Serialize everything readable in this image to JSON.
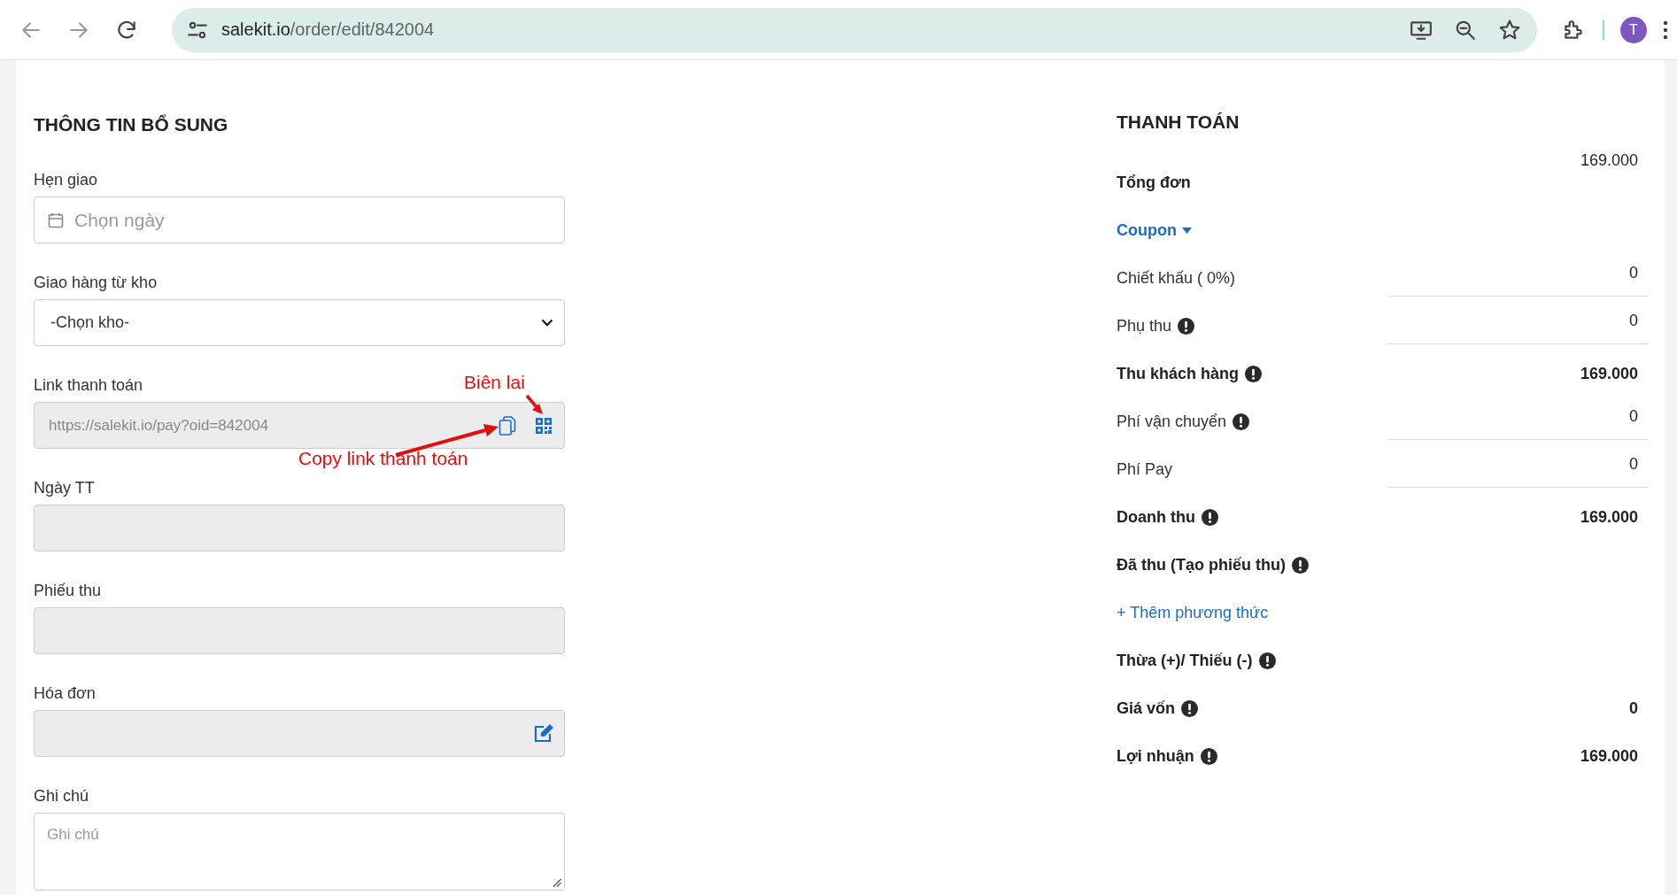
{
  "browser": {
    "url_host": "salekit.io",
    "url_path": "/order/edit/842004",
    "avatar_letter": "T"
  },
  "info": {
    "title": "THÔNG TIN BỔ SUNG",
    "fields": [
      {
        "kind": "date",
        "label": "Hẹn giao",
        "placeholder": "Chọn ngày"
      },
      {
        "kind": "select",
        "label": "Giao hàng từ kho",
        "value": "-Chọn kho-"
      },
      {
        "kind": "link",
        "label": "Link thanh toán",
        "value": "https://salekit.io/pay?oid=842004"
      },
      {
        "kind": "readonly",
        "label": "Ngày TT"
      },
      {
        "kind": "readonly",
        "label": "Phiếu thu"
      },
      {
        "kind": "edit",
        "label": "Hóa đơn"
      },
      {
        "kind": "textarea",
        "label": "Ghi chú",
        "placeholder": "Ghi chú"
      }
    ]
  },
  "annotations": [
    {
      "text": "Biên lai"
    },
    {
      "text": "Copy link thanh toán"
    }
  ],
  "payment": {
    "title": "THANH TOÁN",
    "rows": [
      {
        "kind": "total",
        "label": "Tổng đơn",
        "value": "169.000",
        "label_bold": true,
        "value_bold": false,
        "info": false
      },
      {
        "kind": "dropdown",
        "label": "Coupon"
      },
      {
        "kind": "input",
        "label": "Chiết khấu ( 0%)",
        "value": "0",
        "label_bold": false,
        "info": false
      },
      {
        "kind": "input",
        "label": "Phụ thu",
        "value": "0",
        "label_bold": false,
        "info": true
      },
      {
        "kind": "static",
        "label": "Thu khách hàng",
        "value": "169.000",
        "label_bold": true,
        "value_bold": true,
        "info": true
      },
      {
        "kind": "input",
        "label": "Phí vận chuyển",
        "value": "0",
        "label_bold": false,
        "info": true
      },
      {
        "kind": "input",
        "label": "Phí Pay",
        "value": "0",
        "label_bold": false,
        "info": false
      },
      {
        "kind": "static",
        "label": "Doanh thu",
        "value": "169.000",
        "label_bold": true,
        "value_bold": true,
        "info": true
      },
      {
        "kind": "static",
        "label": "Đã thu (Tạo phiếu thu)",
        "label_bold": true,
        "info": true
      },
      {
        "kind": "link",
        "label": "+ Thêm phương thức"
      },
      {
        "kind": "static",
        "label": "Thừa (+)/ Thiếu (-)",
        "label_bold": true,
        "info": true
      },
      {
        "kind": "static",
        "label": "Giá vốn",
        "value": "0",
        "label_bold": true,
        "value_bold": true,
        "info": true
      },
      {
        "kind": "static",
        "label": "Lợi nhuận",
        "value": "169.000",
        "label_bold": true,
        "value_bold": true,
        "info": true
      }
    ]
  }
}
